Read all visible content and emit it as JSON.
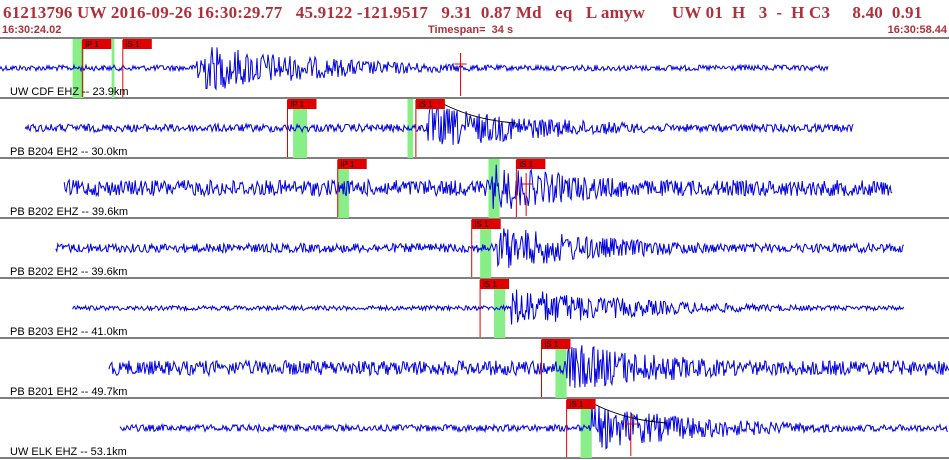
{
  "header": {
    "event_line": "61213796 UW 2016-09-26 16:30:29.77   45.9122 -121.9517   9.31  0.87 Md   eq   L amyw      UW 01  H   3  -  H C3     8.40  0.91",
    "start_time": "16:30:24.02",
    "timespan_label": "Timespan=  34 s",
    "end_time": "16:30:58.44"
  },
  "colors": {
    "header_text": "#b0303a",
    "trace": "#0000e0",
    "pick_box": "#e00000",
    "pick_window": "#88ee88",
    "separator": "#000000"
  },
  "chart_data": {
    "type": "line",
    "title": "",
    "xlabel": "",
    "ylabel": "",
    "x_unit": "s",
    "xlim": [
      0,
      34
    ],
    "channels": [
      {
        "label": "UW CDF EHZ -- 23.9km",
        "trace_span": [
          0,
          29.7
        ],
        "amplitude": 0.1,
        "picks": [
          {
            "label": "iP 1",
            "time": 2.95,
            "window": [
              2.6,
              3.0
            ]
          },
          {
            "label": "iS 1",
            "time": 4.4,
            "window": [
              4.0,
              4.1
            ]
          }
        ],
        "events": [
          {
            "time": 7.0,
            "amplitude": 0.9
          }
        ],
        "red_markers": [
          16.5
        ],
        "decay_curve": false
      },
      {
        "label": "PB B204 EH2 -- 30.0km",
        "trace_span": [
          0.9,
          30.6
        ],
        "amplitude": 0.14,
        "picks": [
          {
            "label": "iP 1",
            "time": 10.3,
            "window": [
              10.5,
              11.0
            ]
          },
          {
            "label": "iS 1",
            "time": 14.9,
            "window": [
              14.6,
              14.8
            ]
          }
        ],
        "events": [
          {
            "time": 15.3,
            "amplitude": 0.8
          }
        ],
        "red_markers": [],
        "decay_curve": true
      },
      {
        "label": "PB B202 EHZ -- 39.6km",
        "trace_span": [
          2.3,
          32.0
        ],
        "amplitude": 0.28,
        "picks": [
          {
            "label": "iP 1",
            "time": 12.1,
            "window": [
              12.1,
              12.5
            ]
          },
          {
            "label": "iS 1",
            "time": 18.5,
            "window": [
              17.5,
              17.9
            ]
          }
        ],
        "events": [
          {
            "time": 17.6,
            "amplitude": 0.85
          }
        ],
        "red_markers": [
          18.85
        ],
        "decay_curve": false
      },
      {
        "label": "PB B202 EH2 -- 39.6km",
        "trace_span": [
          2.0,
          32.4
        ],
        "amplitude": 0.16,
        "picks": [
          {
            "label": "iS 1",
            "time": 16.9,
            "window": [
              17.2,
              17.6
            ]
          }
        ],
        "events": [
          {
            "time": 17.8,
            "amplitude": 0.8
          }
        ],
        "red_markers": [],
        "decay_curve": false
      },
      {
        "label": "PB B203 EH2 -- 41.0km",
        "trace_span": [
          2.6,
          32.4
        ],
        "amplitude": 0.08,
        "picks": [
          {
            "label": "iS 1",
            "time": 17.2,
            "window": [
              17.7,
              18.1
            ]
          }
        ],
        "events": [
          {
            "time": 18.3,
            "amplitude": 0.75
          }
        ],
        "red_markers": [],
        "decay_curve": false
      },
      {
        "label": "PB B201 EH2 -- 49.7km",
        "trace_span": [
          3.9,
          34.0
        ],
        "amplitude": 0.26,
        "picks": [
          {
            "label": "iS 1",
            "time": 19.4,
            "window": [
              19.9,
              20.3
            ]
          }
        ],
        "events": [
          {
            "time": 20.3,
            "amplitude": 0.9
          }
        ],
        "red_markers": [],
        "decay_curve": false
      },
      {
        "label": "UW ELK EHZ -- 53.1km",
        "trace_span": [
          4.3,
          34.0
        ],
        "amplitude": 0.12,
        "picks": [
          {
            "label": "iS 1",
            "time": 20.3,
            "window": [
              20.8,
              21.2
            ]
          }
        ],
        "events": [
          {
            "time": 21.2,
            "amplitude": 0.8
          }
        ],
        "red_markers": [
          22.6
        ],
        "decay_curve": true
      }
    ]
  }
}
